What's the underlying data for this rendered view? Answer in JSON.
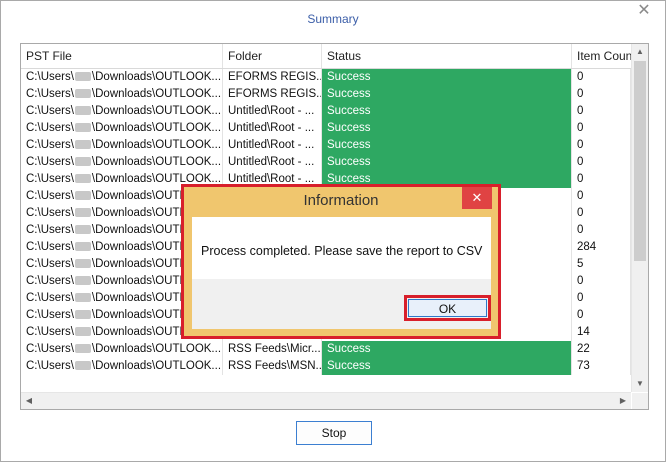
{
  "window": {
    "title": "Summary",
    "close_glyph": "✕"
  },
  "grid": {
    "columns": [
      "PST File",
      "Folder",
      "Status",
      "Item Count"
    ],
    "rows": [
      {
        "file_prefix": "C:\\Users\\",
        "file_suffix": "\\Downloads\\OUTLOOK....",
        "folder": "EFORMS REGIS...",
        "status": "Success",
        "count": "0"
      },
      {
        "file_prefix": "C:\\Users\\",
        "file_suffix": "\\Downloads\\OUTLOOK....",
        "folder": "EFORMS REGIS...",
        "status": "Success",
        "count": "0"
      },
      {
        "file_prefix": "C:\\Users\\",
        "file_suffix": "\\Downloads\\OUTLOOK....",
        "folder": "Untitled\\Root - ...",
        "status": "Success",
        "count": "0"
      },
      {
        "file_prefix": "C:\\Users\\",
        "file_suffix": "\\Downloads\\OUTLOOK....",
        "folder": "Untitled\\Root - ...",
        "status": "Success",
        "count": "0"
      },
      {
        "file_prefix": "C:\\Users\\",
        "file_suffix": "\\Downloads\\OUTLOOK....",
        "folder": "Untitled\\Root - ...",
        "status": "Success",
        "count": "0"
      },
      {
        "file_prefix": "C:\\Users\\",
        "file_suffix": "\\Downloads\\OUTLOOK....",
        "folder": "Untitled\\Root - ...",
        "status": "Success",
        "count": "0"
      },
      {
        "file_prefix": "C:\\Users\\",
        "file_suffix": "\\Downloads\\OUTLOOK....",
        "folder": "Untitled\\Root - ...",
        "status": "Success",
        "count": "0"
      },
      {
        "file_prefix": "C:\\Users\\",
        "file_suffix": "\\Downloads\\OUTL",
        "folder": "",
        "status": "",
        "count": "0"
      },
      {
        "file_prefix": "C:\\Users\\",
        "file_suffix": "\\Downloads\\OUTL",
        "folder": "",
        "status": "",
        "count": "0"
      },
      {
        "file_prefix": "C:\\Users\\",
        "file_suffix": "\\Downloads\\OUTL",
        "folder": "",
        "status": "",
        "count": "0"
      },
      {
        "file_prefix": "C:\\Users\\",
        "file_suffix": "\\Downloads\\OUTL",
        "folder": "",
        "status": "",
        "count": "284"
      },
      {
        "file_prefix": "C:\\Users\\",
        "file_suffix": "\\Downloads\\OUTL",
        "folder": "",
        "status": "",
        "count": "5"
      },
      {
        "file_prefix": "C:\\Users\\",
        "file_suffix": "\\Downloads\\OUTL",
        "folder": "",
        "status": "",
        "count": "0"
      },
      {
        "file_prefix": "C:\\Users\\",
        "file_suffix": "\\Downloads\\OUTL",
        "folder": "",
        "status": "",
        "count": "0"
      },
      {
        "file_prefix": "C:\\Users\\",
        "file_suffix": "\\Downloads\\OUTL",
        "folder": "",
        "status": "",
        "count": "0"
      },
      {
        "file_prefix": "C:\\Users\\",
        "file_suffix": "\\Downloads\\OUTL",
        "folder": "",
        "status": "",
        "count": "14"
      },
      {
        "file_prefix": "C:\\Users\\",
        "file_suffix": "\\Downloads\\OUTLOOK....",
        "folder": "RSS Feeds\\Micr...",
        "status": "Success",
        "count": "22"
      },
      {
        "file_prefix": "C:\\Users\\",
        "file_suffix": "\\Downloads\\OUTLOOK....",
        "folder": "RSS Feeds\\MSN...",
        "status": "Success",
        "count": "73"
      }
    ]
  },
  "stop_label": "Stop",
  "dialog": {
    "title": "Information",
    "close_glyph": "✕",
    "message": "Process completed. Please save the report to CSV",
    "ok_label": "OK"
  },
  "colors": {
    "success": "#2ea862",
    "dialog_title_bg": "#f0c66e",
    "highlight": "#d81f2b"
  }
}
